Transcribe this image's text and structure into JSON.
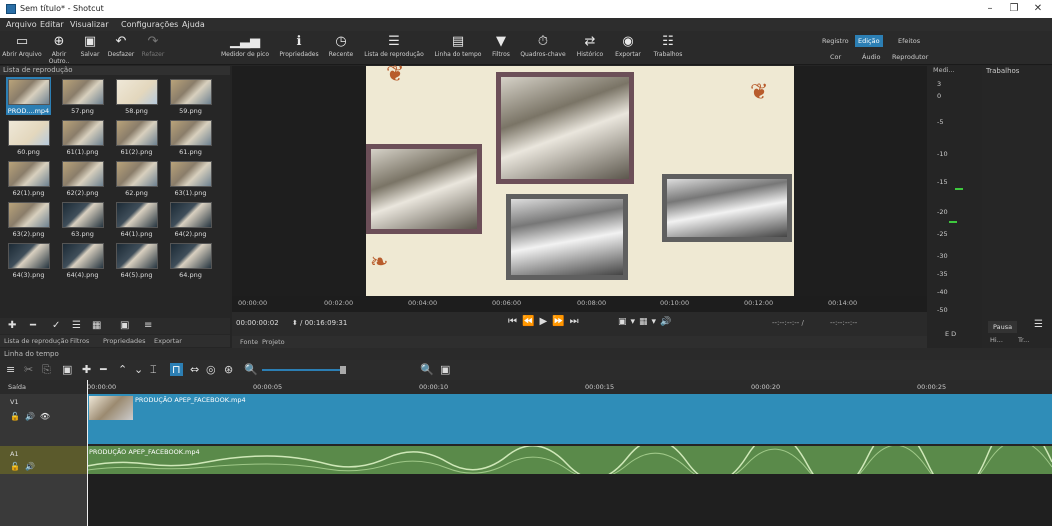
{
  "window": {
    "title": "Sem título* - Shotcut"
  },
  "menu": [
    "Arquivo",
    "Editar",
    "Visualizar",
    "Configurações",
    "Ajuda"
  ],
  "toolbar": {
    "buttons": [
      {
        "label": "Abrir Arquivo",
        "icon": "folder-icon"
      },
      {
        "label": "Abrir Outro..",
        "icon": "open-other-icon"
      },
      {
        "label": "Salvar",
        "icon": "save-icon"
      },
      {
        "label": "Desfazer",
        "icon": "undo-icon"
      },
      {
        "label": "Refazer",
        "icon": "redo-icon"
      },
      {
        "label": "Medidor de pico",
        "icon": "peak-meter-icon"
      },
      {
        "label": "Propriedades",
        "icon": "info-icon"
      },
      {
        "label": "Recente",
        "icon": "clock-icon"
      },
      {
        "label": "Lista de reprodução",
        "icon": "list-icon"
      },
      {
        "label": "Linha do tempo",
        "icon": "timeline-icon"
      },
      {
        "label": "Filtros",
        "icon": "filter-icon"
      },
      {
        "label": "Quadros-chave",
        "icon": "stopwatch-icon"
      },
      {
        "label": "Histórico",
        "icon": "history-icon"
      },
      {
        "label": "Exportar",
        "icon": "export-icon"
      },
      {
        "label": "Trabalhos",
        "icon": "jobs-icon"
      }
    ],
    "layouts_top": [
      "Registro",
      "Edição",
      "Efeitos"
    ],
    "layouts_bottom": [
      "Cor",
      "Áudio",
      "Reprodutor"
    ]
  },
  "playlist": {
    "title": "Lista de reprodução",
    "items": [
      "PROD....mp4",
      "57.png",
      "58.png",
      "59.png",
      "60.png",
      "61(1).png",
      "61(2).png",
      "61.png",
      "62(1).png",
      "62(2).png",
      "62.png",
      "63(1).png",
      "63(2).png",
      "63.png",
      "64(1).png",
      "64(2).png",
      "64(3).png",
      "64(4).png",
      "64(5).png",
      "64.png"
    ],
    "tabs": [
      "Lista de reprodução",
      "Filtros",
      "Propriedades",
      "Exportar"
    ]
  },
  "viewer": {
    "ruler": [
      "00:00:00",
      "00:02:00",
      "00:04:00",
      "00:06:00",
      "00:08:00",
      "00:10:00",
      "00:12:00",
      "00:14:00"
    ],
    "position": "00:00:00:02",
    "duration": "/ 00:16:09:31",
    "in_out": "--:--:--:-- /",
    "out": "--:--:--:--",
    "tabs": [
      "Fonte",
      "Projeto"
    ]
  },
  "meter": {
    "title": "Medi...",
    "labels": [
      "3",
      "0",
      "-5",
      "-10",
      "-15",
      "-20",
      "-25",
      "-30",
      "-35",
      "-40",
      "-50"
    ],
    "channels": "E D"
  },
  "jobs": {
    "title": "Trabalhos",
    "pause": "Pausa",
    "tabs": [
      "Hi...",
      "Tr..."
    ]
  },
  "timeline": {
    "title": "Linha do tempo",
    "output": "Saída",
    "ticks": [
      "00:00:00",
      "00:00:05",
      "00:00:10",
      "00:00:15",
      "00:00:20",
      "00:00:25"
    ],
    "tracks": [
      {
        "name": "V1",
        "clip": "PRODUÇÃO APEP_FACEBOOK.mp4"
      },
      {
        "name": "A1",
        "clip": "PRODUÇÃO APEP_FACEBOOK.mp4"
      }
    ]
  },
  "colors": {
    "accent": "#2c7fb4",
    "video_clip": "#2f8db8",
    "audio_clip": "#5a8a4a"
  }
}
